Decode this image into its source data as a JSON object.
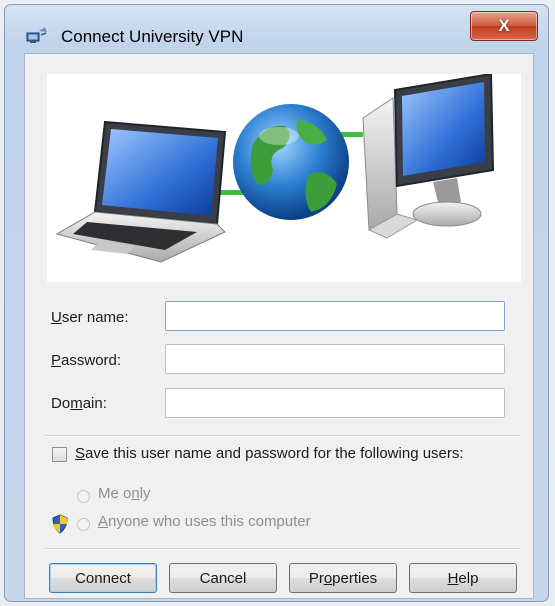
{
  "window": {
    "title": "Connect University VPN",
    "close_label": "X",
    "icon": "network-connection-icon"
  },
  "banner": {
    "image": "laptop-globe-desktop-illustration",
    "icons": [
      "laptop-icon",
      "globe-icon",
      "desktop-computer-icon"
    ]
  },
  "form": {
    "username": {
      "label_pre": "",
      "label_key": "U",
      "label_post": "ser name:",
      "value": ""
    },
    "password": {
      "label_pre": "",
      "label_key": "P",
      "label_post": "assword:",
      "value": ""
    },
    "domain": {
      "label_pre": "Do",
      "label_key": "m",
      "label_post": "ain:",
      "value": ""
    }
  },
  "save_credentials": {
    "checked": false,
    "label_key": "S",
    "label_post": "ave this user name and password for the following users:"
  },
  "users_options": {
    "me_only": {
      "label_pre": "Me o",
      "label_key": "n",
      "label_post": "ly",
      "enabled": false
    },
    "anyone": {
      "label_pre": "",
      "label_key": "A",
      "label_post": "nyone who uses this computer",
      "enabled": false
    }
  },
  "buttons": {
    "connect": "Connect",
    "cancel": "Cancel",
    "properties_pre": "Pr",
    "properties_key": "o",
    "properties_post": "perties",
    "help_key": "H",
    "help_post": "elp"
  },
  "colors": {
    "title_bar": "#c7d8ec",
    "close_button": "#c33b1f",
    "default_button_border": "#3c7fb1",
    "link_green": "#3fbf3f"
  }
}
